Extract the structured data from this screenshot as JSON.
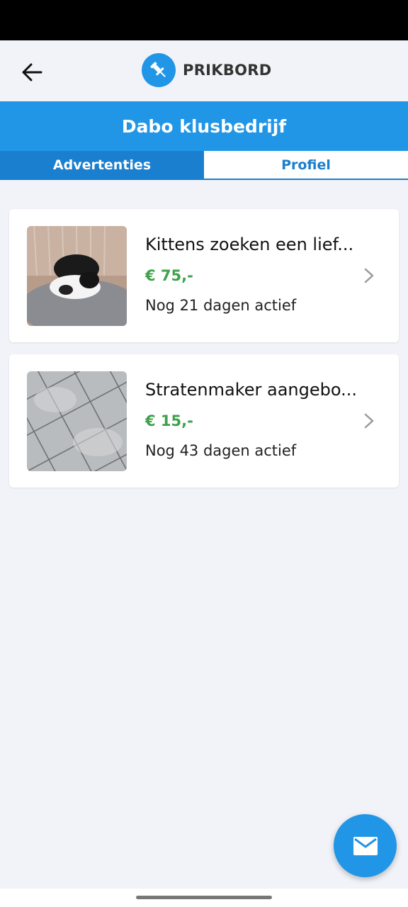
{
  "app": {
    "logo_text": "PRIKBORD",
    "brand_color": "#2196e6",
    "price_color": "#3ea14a"
  },
  "header": {
    "title": "Dabo klusbedrijf"
  },
  "tabs": [
    {
      "label": "Advertenties",
      "active": false
    },
    {
      "label": "Profiel",
      "active": true
    }
  ],
  "listings": [
    {
      "title": "Kittens zoeken een lief...",
      "price": "€ 75,-",
      "status": "Nog 21 dagen actief",
      "image": "kittens-photo"
    },
    {
      "title": "Stratenmaker aangebo...",
      "price": "€ 15,-",
      "status": "Nog 43 dagen actief",
      "image": "tiles-photo"
    }
  ],
  "icons": {
    "back": "arrow-left-icon",
    "logo": "pushpin-icon",
    "chevron": "chevron-right-icon",
    "fab": "mail-icon"
  }
}
